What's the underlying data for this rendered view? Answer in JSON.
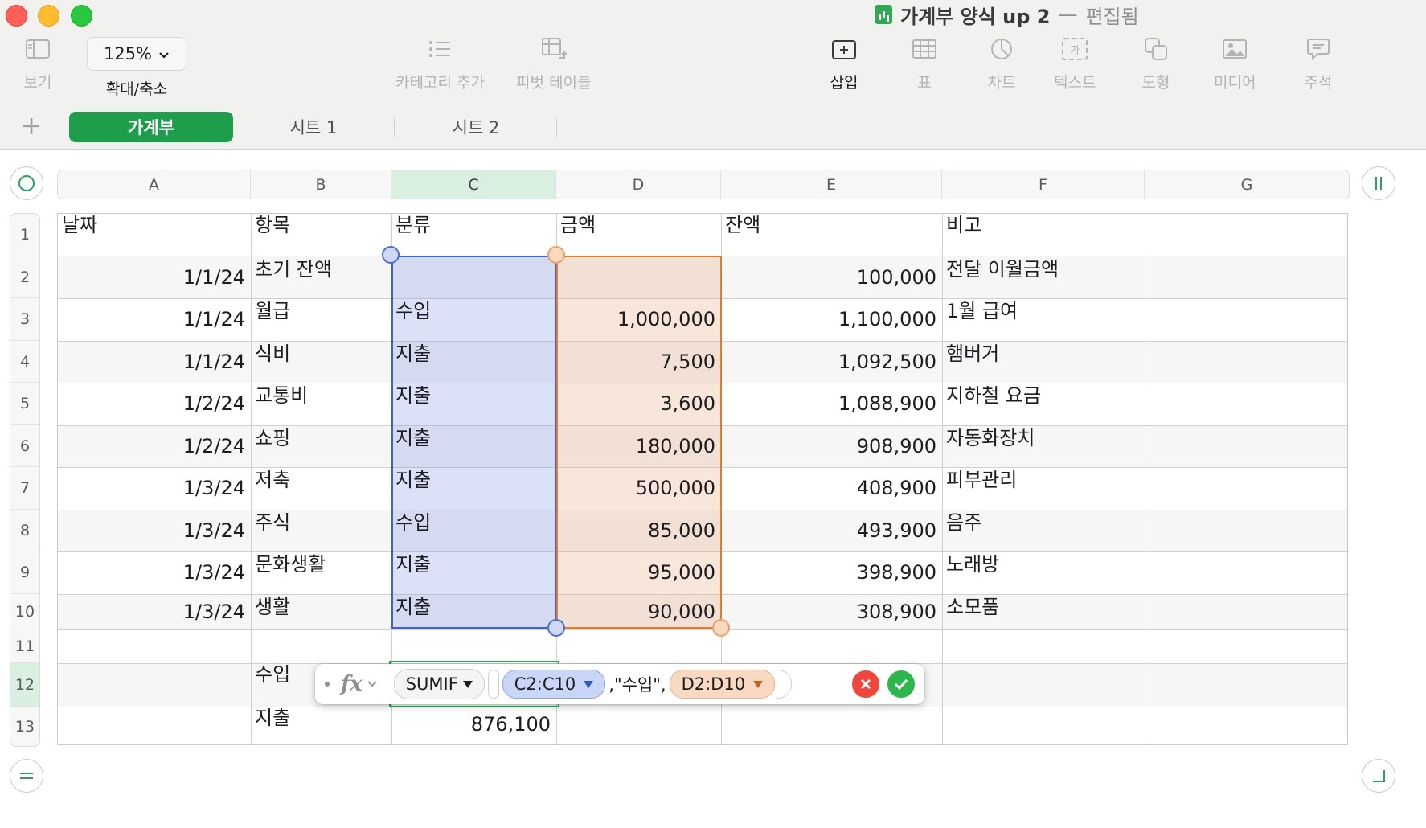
{
  "window": {
    "doc_name": "가계부 양식 up 2",
    "separator": "—",
    "status": "편집됨"
  },
  "toolbar": {
    "view_label": "보기",
    "zoom_value": "125%",
    "zoom_label": "확대/축소",
    "category_label": "카테고리 추가",
    "pivot_label": "피벗 테이블",
    "insert_label": "삽입",
    "table_label": "표",
    "chart_label": "차트",
    "text_label": "텍스트",
    "shape_label": "도형",
    "media_label": "미디어",
    "comment_label": "주석",
    "text_icon_glyph": "가"
  },
  "tabs": {
    "add": "+",
    "items": [
      {
        "label": "가계부",
        "active": true
      },
      {
        "label": "시트 1",
        "active": false
      },
      {
        "label": "시트 2",
        "active": false
      }
    ]
  },
  "columns": [
    "A",
    "B",
    "C",
    "D",
    "E",
    "F",
    "G"
  ],
  "rows": [
    "1",
    "2",
    "3",
    "4",
    "5",
    "6",
    "7",
    "8",
    "9",
    "10",
    "11",
    "12",
    "13"
  ],
  "table": {
    "headers": [
      "날짜",
      "항목",
      "분류",
      "금액",
      "잔액",
      "비고"
    ],
    "data": [
      [
        "1/1/24",
        "초기 잔액",
        "",
        "",
        "100,000",
        "전달 이월금액"
      ],
      [
        "1/1/24",
        "월급",
        "수입",
        "1,000,000",
        "1,100,000",
        "1월 급여"
      ],
      [
        "1/1/24",
        "식비",
        "지출",
        "7,500",
        "1,092,500",
        "햄버거"
      ],
      [
        "1/2/24",
        "교통비",
        "지출",
        "3,600",
        "1,088,900",
        "지하철 요금"
      ],
      [
        "1/2/24",
        "쇼핑",
        "지출",
        "180,000",
        "908,900",
        "자동화장치"
      ],
      [
        "1/3/24",
        "저축",
        "지출",
        "500,000",
        "408,900",
        "피부관리"
      ],
      [
        "1/3/24",
        "주식",
        "수입",
        "85,000",
        "493,900",
        "음주"
      ],
      [
        "1/3/24",
        "문화생활",
        "지출",
        "95,000",
        "398,900",
        "노래방"
      ],
      [
        "1/3/24",
        "생활",
        "지출",
        "90,000",
        "308,900",
        "소모품"
      ]
    ],
    "summary": [
      {
        "label": "수입",
        "value": ""
      },
      {
        "label": "지출",
        "value": "876,100"
      }
    ]
  },
  "formula": {
    "function": "SUMIF",
    "range1": "C2:C10",
    "criteria": ",\"수입\",",
    "range2": "D2:D10"
  },
  "colors": {
    "accent_green": "#1e9e4b",
    "range_blue": "#3b62d4",
    "range_orange": "#e07c2c",
    "cancel_red": "#f0463b",
    "confirm_green": "#2ab84a"
  }
}
